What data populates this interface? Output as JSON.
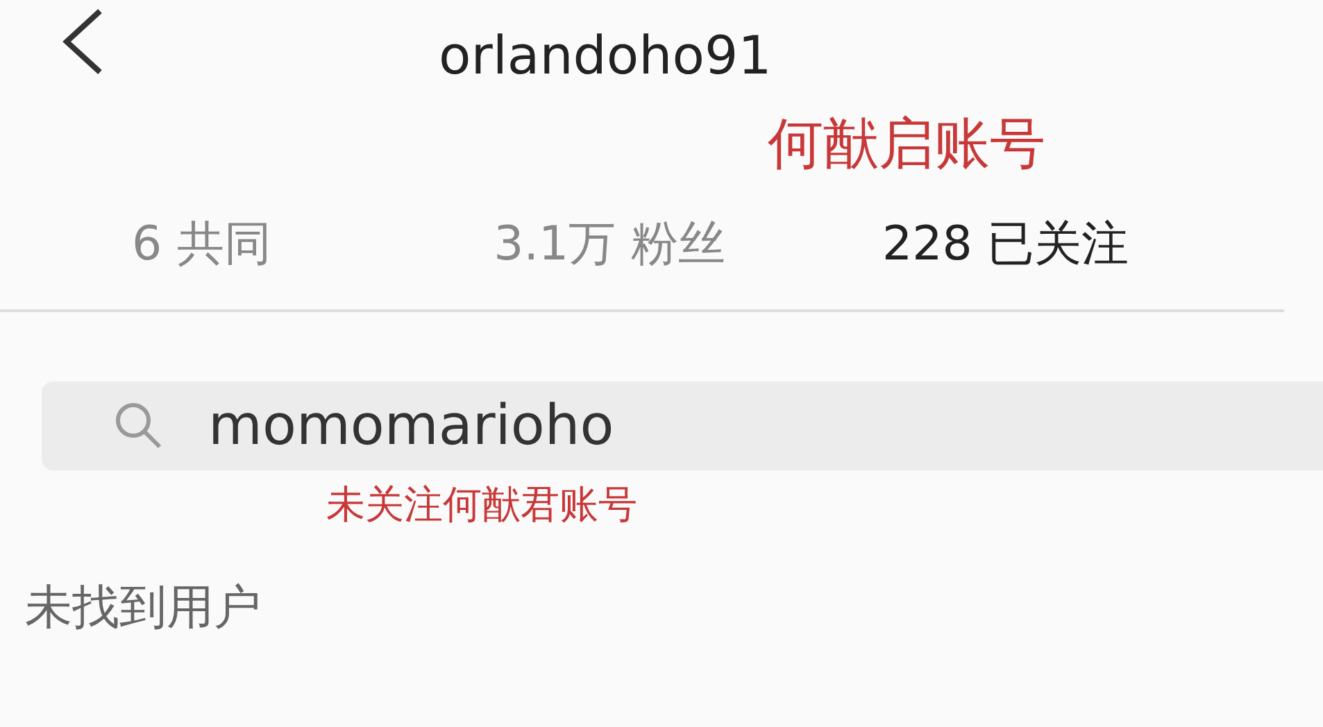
{
  "header": {
    "title": "orlandoho91"
  },
  "header_note": "何猷启账号",
  "stats": [
    {
      "value": "6",
      "label": "共同",
      "emphasis": false
    },
    {
      "value": "3.1万",
      "label": "粉丝",
      "emphasis": false
    },
    {
      "value": "228",
      "label": "已关注",
      "emphasis": true
    }
  ],
  "search": {
    "value": "momomarioho"
  },
  "search_note": "未关注何猷君账号",
  "result_message": "未找到用户"
}
